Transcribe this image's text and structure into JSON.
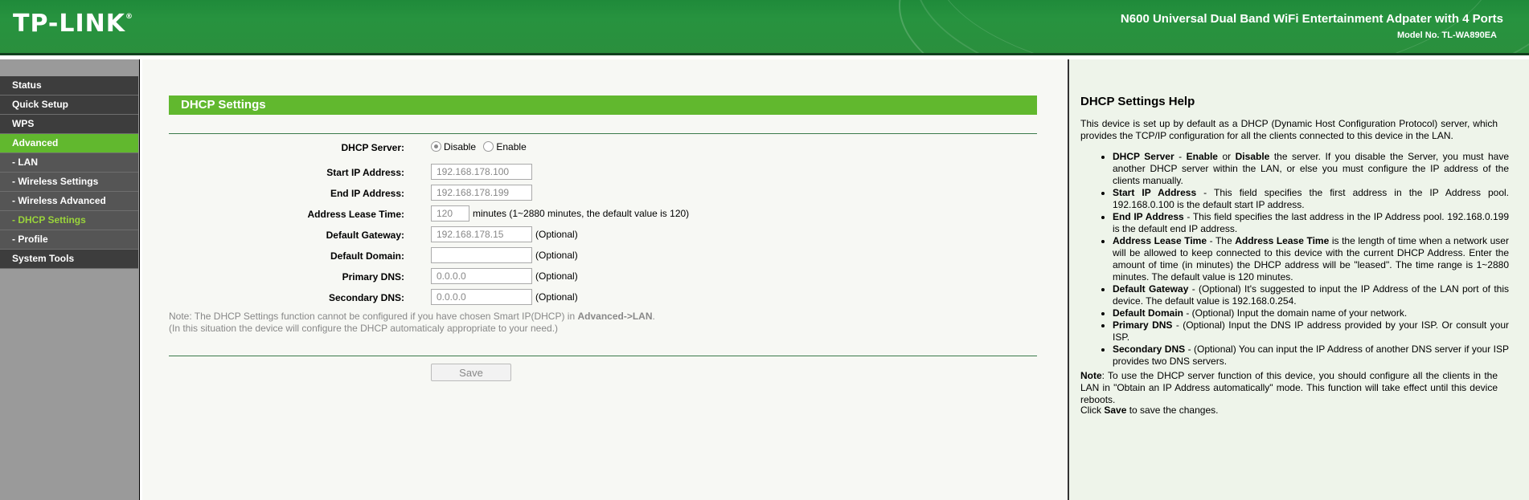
{
  "header": {
    "logo_text": "TP-LINK",
    "logo_reg": "®",
    "product_title": "N600 Universal Dual Band WiFi Entertainment Adpater with 4 Ports",
    "model_no": "Model No. TL-WA890EA"
  },
  "sidebar": {
    "items": [
      {
        "label": "Status"
      },
      {
        "label": "Quick Setup"
      },
      {
        "label": "WPS"
      },
      {
        "label": "Advanced"
      },
      {
        "label": "- LAN"
      },
      {
        "label": "- Wireless Settings"
      },
      {
        "label": "- Wireless Advanced"
      },
      {
        "label": "- DHCP Settings"
      },
      {
        "label": "- Profile"
      },
      {
        "label": "System Tools"
      }
    ]
  },
  "main": {
    "title": "DHCP Settings",
    "dhcp_server": {
      "label": "DHCP Server:",
      "options": [
        "Disable",
        "Enable"
      ],
      "selected": "Disable"
    },
    "start_ip": {
      "label": "Start IP Address:",
      "value": "192.168.178.100"
    },
    "end_ip": {
      "label": "End IP Address:",
      "value": "192.168.178.199"
    },
    "lease_time": {
      "label": "Address Lease Time:",
      "value": "120",
      "suffix": "minutes (1~2880 minutes, the default value is 120)"
    },
    "gateway": {
      "label": "Default Gateway:",
      "value": "192.168.178.15",
      "suffix": "(Optional)"
    },
    "domain": {
      "label": "Default Domain:",
      "value": "",
      "suffix": "(Optional)"
    },
    "primary_dns": {
      "label": "Primary DNS:",
      "value": "0.0.0.0",
      "suffix": "(Optional)"
    },
    "secondary_dns": {
      "label": "Secondary DNS:",
      "value": "0.0.0.0",
      "suffix": "(Optional)"
    },
    "note_line1_a": "Note: The DHCP Settings function cannot be configured if you have chosen Smart IP(DHCP) in ",
    "note_line1_b": "Advanced->LAN",
    "note_line1_c": ".",
    "note_line2": "(In this situation the device will configure the DHCP automaticaly appropriate to your need.)",
    "save_label": "Save"
  },
  "help": {
    "title": "DHCP Settings Help",
    "intro": "This device is set up by default as a DHCP (Dynamic Host Configuration Protocol) server, which provides the TCP/IP configuration for all the clients connected to this device in the LAN.",
    "items": [
      {
        "b1": "DHCP Server",
        "t1": " - ",
        "b2": "Enable",
        "t2": " or ",
        "b3": "Disable",
        "t3": " the server. If you disable the Server, you must have another DHCP server within the LAN, or else you must configure the IP address of the clients manually."
      },
      {
        "b1": "Start IP Address",
        "t1": " - This field specifies the first address in the IP Address pool. 192.168.0.100 is the default start IP address.",
        "b2": "",
        "t2": "",
        "b3": "",
        "t3": ""
      },
      {
        "b1": "End IP Address",
        "t1": " - This field specifies the last address in the IP Address pool. 192.168.0.199 is the default end IP address.",
        "b2": "",
        "t2": "",
        "b3": "",
        "t3": ""
      },
      {
        "b1": "Address Lease Time",
        "t1": " - The ",
        "b2": "Address Lease Time",
        "t2": " is the length of time when a network user will be allowed to keep connected to this device with the current DHCP Address. Enter the amount of time (in minutes) the DHCP address will be \"leased\". The time range is 1~2880 minutes. The default value is 120 minutes.",
        "b3": "",
        "t3": ""
      },
      {
        "b1": "Default Gateway",
        "t1": " - (Optional) It's suggested to input the IP Address of the LAN port of this device. The default value is 192.168.0.254.",
        "b2": "",
        "t2": "",
        "b3": "",
        "t3": ""
      },
      {
        "b1": "Default Domain",
        "t1": " - (Optional) Input the domain name of your network.",
        "b2": "",
        "t2": "",
        "b3": "",
        "t3": ""
      },
      {
        "b1": "Primary DNS",
        "t1": " - (Optional) Input the DNS IP address provided by your ISP. Or consult your ISP.",
        "b2": "",
        "t2": "",
        "b3": "",
        "t3": ""
      },
      {
        "b1": "Secondary DNS",
        "t1": " - (Optional) You can input the IP Address of another DNS server if your ISP provides two DNS servers.",
        "b2": "",
        "t2": "",
        "b3": "",
        "t3": ""
      }
    ],
    "note_b": "Note",
    "note_t": ": To use the DHCP server function of this device, you should configure all the clients in the LAN in \"Obtain an IP Address automatically\" mode. This function will take effect until this device reboots.",
    "save_a": "Click ",
    "save_b": "Save",
    "save_c": " to save the changes."
  },
  "colors": {
    "header_green": "#27933f",
    "accent_green": "#61b82e",
    "sidebar_dark": "#3d3d3d",
    "help_bg": "#eef4ea"
  }
}
